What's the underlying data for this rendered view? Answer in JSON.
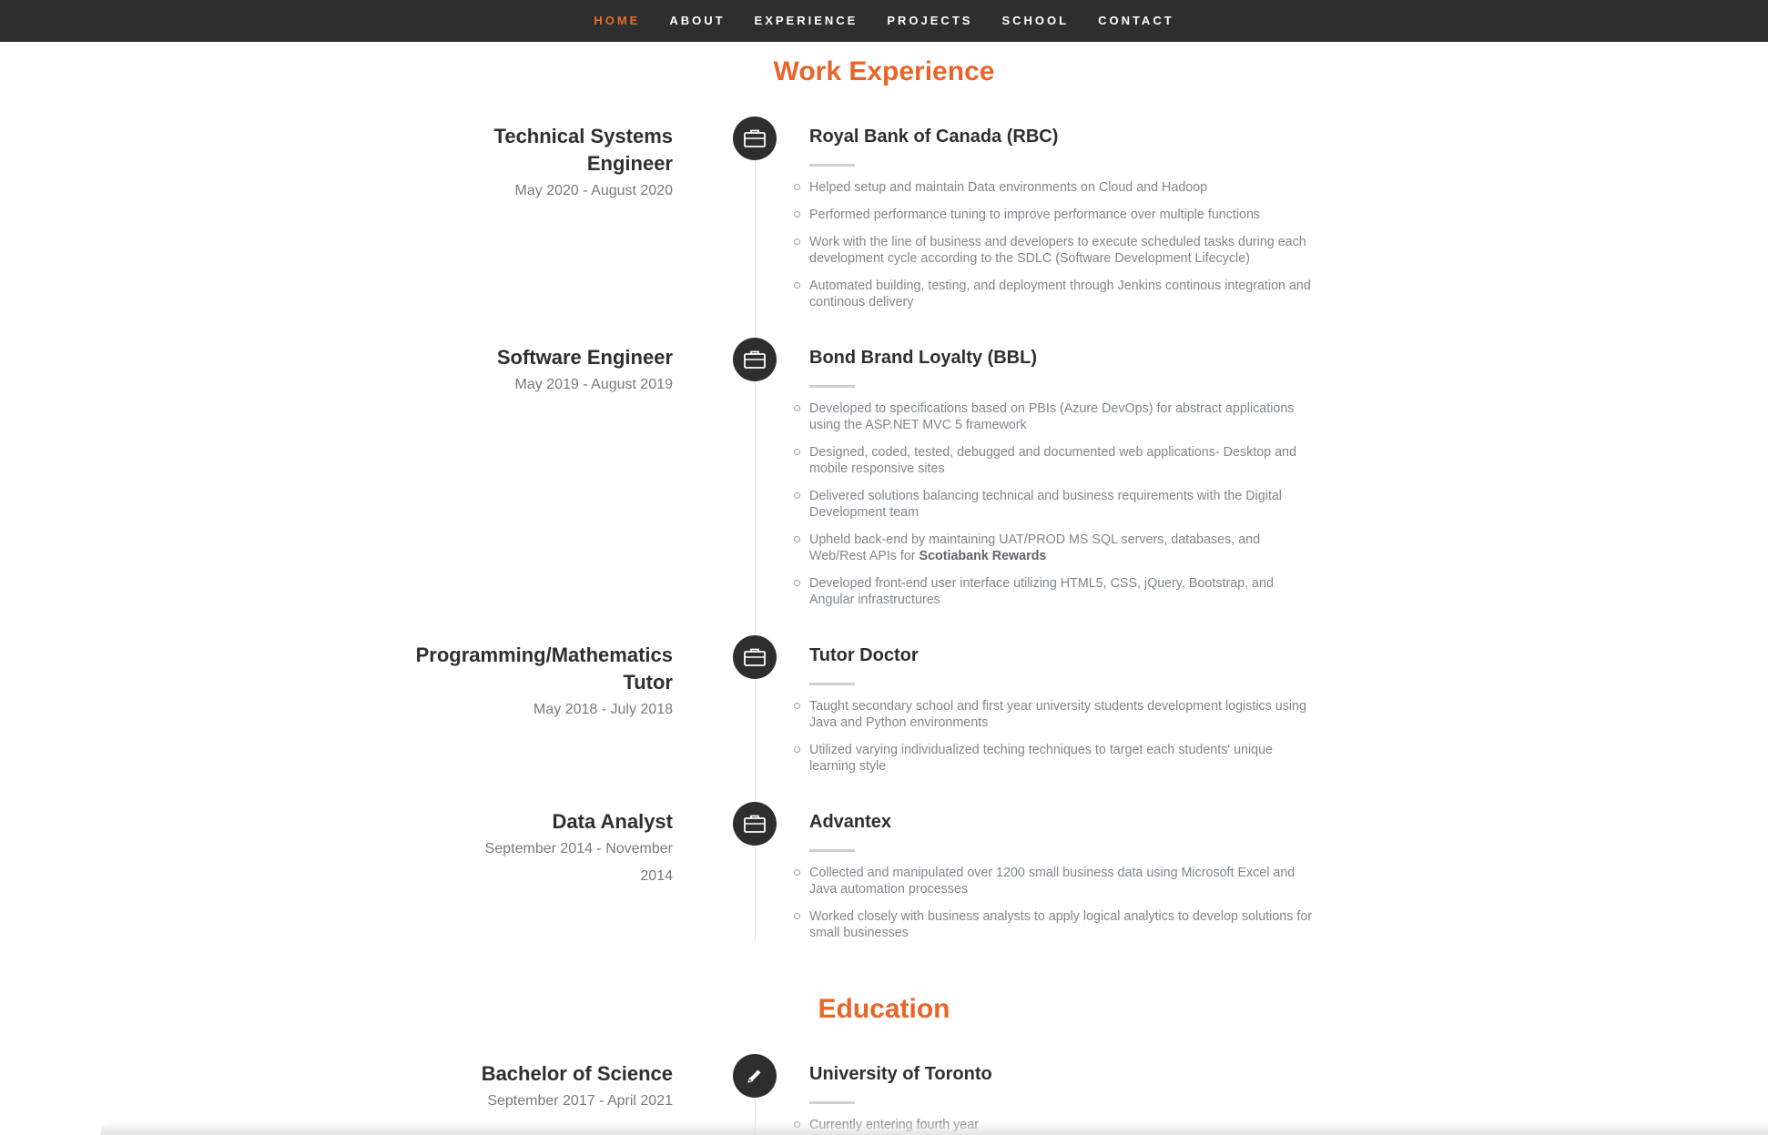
{
  "nav": {
    "items": [
      {
        "label": "HOME",
        "active": true
      },
      {
        "label": "ABOUT",
        "active": false
      },
      {
        "label": "EXPERIENCE",
        "active": false
      },
      {
        "label": "PROJECTS",
        "active": false
      },
      {
        "label": "SCHOOL",
        "active": false
      },
      {
        "label": "CONTACT",
        "active": false
      }
    ]
  },
  "colors": {
    "accent": "#e8652a",
    "nav_bg": "#2e2e2e",
    "icon_bg": "#2e2e2e"
  },
  "work": {
    "title": "Work Experience",
    "entries": [
      {
        "role_line1": "Technical Systems",
        "role_line2": "Engineer",
        "dates": "May 2020 - August 2020",
        "icon": "briefcase-icon",
        "company": "Royal Bank of Canada (RBC)",
        "bullets": [
          "Helped setup and maintain Data environments on Cloud and Hadoop",
          "Performed performance tuning to improve performance over multiple functions",
          "Work with the line of business and developers to execute scheduled tasks during each development cycle according to the SDLC (Software Development Lifecycle)",
          "Automated building, testing, and deployment through Jenkins continous integration and continous delivery"
        ]
      },
      {
        "role_line1": "Software Engineer",
        "dates": "May 2019 - August 2019",
        "icon": "briefcase-icon",
        "company": "Bond Brand Loyalty (BBL)",
        "bullets": [
          "Developed to specifications based on PBIs (Azure DevOps) for abstract applications using the ASP.NET MVC 5 framework",
          "Designed, coded, tested, debugged and documented web applications- Desktop and mobile responsive sites",
          "Delivered solutions balancing technical and business requirements with the Digital Development team",
          "Upheld back-end by maintaining UAT/PROD MS SQL servers, databases, and Web/Rest APIs for",
          "Developed front-end user interface utilizing HTML5, CSS, jQuery, Bootstrap, and Angular infrastructures"
        ],
        "bold_suffix": "Scotiabank Rewards"
      },
      {
        "role_line1": "Programming/Mathematics",
        "role_line2": "Tutor",
        "dates": "May 2018 - July 2018",
        "icon": "briefcase-icon",
        "company": "Tutor Doctor",
        "bullets": [
          "Taught secondary school and first year university students development logistics using Java and Python environments",
          "Utilized varying individualized teching techniques to target each students' unique learning style"
        ]
      },
      {
        "role_line1": "Data Analyst",
        "dates_line1": "September 2014 - November",
        "dates_line2": "2014",
        "icon": "briefcase-icon",
        "company": "Advantex",
        "bullets": [
          "Collected and manipulated over 1200 small business data using Microsoft Excel and Java automation processes",
          "Worked closely with business analysts to apply logical analytics to develop solutions for small businesses"
        ]
      }
    ]
  },
  "education": {
    "title": "Education",
    "entries": [
      {
        "role_line1": "Bachelor of Science",
        "dates": "September 2017 - April 2021",
        "icon": "pencil-icon",
        "company": "University of Toronto",
        "bullets": [
          "Currently entering fourth year"
        ]
      }
    ]
  }
}
